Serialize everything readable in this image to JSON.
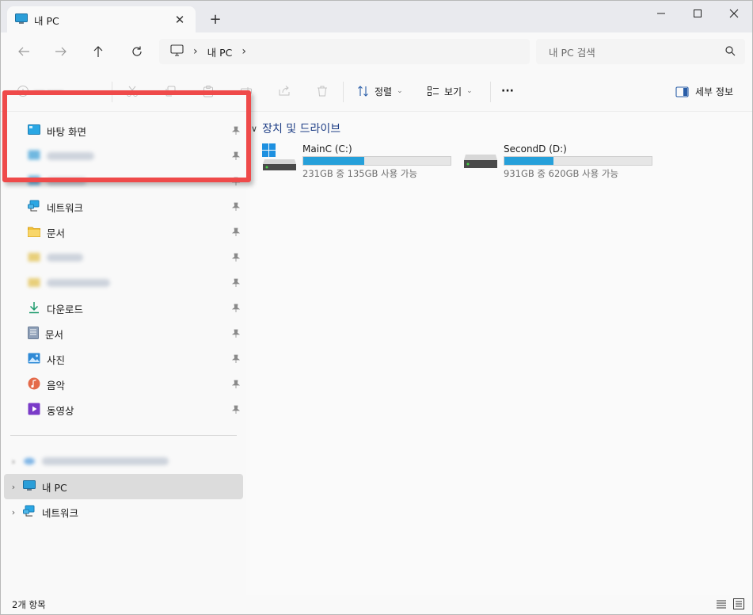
{
  "window": {
    "tab_title": "내 PC",
    "new_tab": "+",
    "tab_close": "✕"
  },
  "address": {
    "crumbs": [
      "내 PC"
    ],
    "search_placeholder": "내 PC 검색"
  },
  "toolbar": {
    "sort_label": "정렬",
    "view_label": "보기",
    "more_label": "···",
    "details_label": "세부 정보"
  },
  "sidebar": {
    "quick_access": [
      {
        "label": "바탕 화면",
        "icon": "desktop-icon",
        "pinned": true
      },
      {
        "label": "",
        "icon": "desktop-icon",
        "pinned": true,
        "blurred": true
      },
      {
        "label": "",
        "icon": "desktop-icon",
        "pinned": true,
        "blurred": true
      },
      {
        "label": "네트워크",
        "icon": "network-icon",
        "pinned": true
      },
      {
        "label": "문서",
        "icon": "folder-icon",
        "pinned": true
      },
      {
        "label": "",
        "icon": "folder-icon",
        "pinned": true,
        "blurred": true
      },
      {
        "label": "",
        "icon": "folder-icon",
        "pinned": true,
        "blurred": true
      },
      {
        "label": "다운로드",
        "icon": "download-icon",
        "pinned": true
      },
      {
        "label": "문서",
        "icon": "documents-icon",
        "pinned": true
      },
      {
        "label": "사진",
        "icon": "pictures-icon",
        "pinned": true
      },
      {
        "label": "음악",
        "icon": "music-icon",
        "pinned": true
      },
      {
        "label": "동영상",
        "icon": "videos-icon",
        "pinned": true
      }
    ],
    "tree": [
      {
        "label": "",
        "icon": "cloud-icon",
        "blurred": true
      },
      {
        "label": "내 PC",
        "icon": "pc-icon",
        "selected": true
      },
      {
        "label": "네트워크",
        "icon": "network-icon"
      }
    ]
  },
  "content": {
    "section_title": "장치 및 드라이브",
    "drives": [
      {
        "name": "MainC (C:)",
        "info": "231GB 중 135GB 사용 가능",
        "used_fraction": 0.416,
        "os": true
      },
      {
        "name": "SecondD (D:)",
        "info": "931GB 중 620GB 사용 가능",
        "used_fraction": 0.334,
        "os": false
      }
    ]
  },
  "status": {
    "item_count": "2개 항목"
  },
  "colors": {
    "accent": "#26a0da",
    "highlight": "#ef4a4a",
    "section_title": "#1f3f86"
  }
}
